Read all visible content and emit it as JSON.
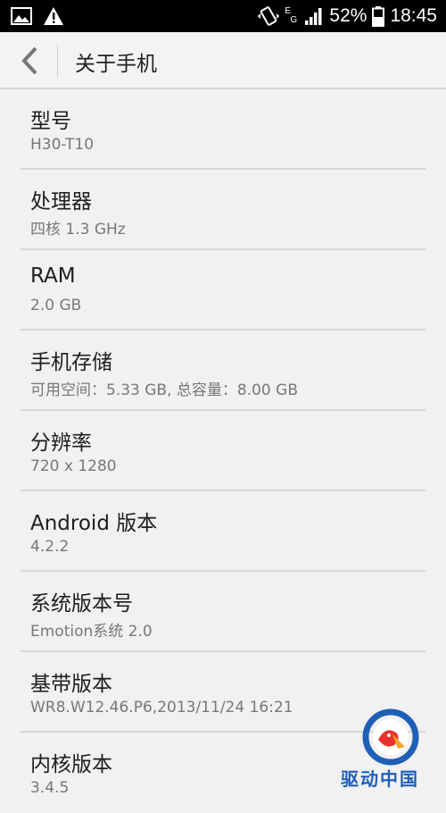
{
  "status_bar": {
    "battery_percent": "52%",
    "time": "18:45",
    "network_type_1": "E",
    "network_type_2": "G",
    "icons": [
      "image-notification-icon",
      "warning-icon",
      "vibrate-icon",
      "signal-icon",
      "battery-icon"
    ]
  },
  "action_bar": {
    "title": "关于手机",
    "back_icon": "chevron-left-icon"
  },
  "items": [
    {
      "label": "型号",
      "value": "H30-T10"
    },
    {
      "label": "处理器",
      "value": "四核 1.3 GHz"
    },
    {
      "label": "RAM",
      "value": "2.0 GB"
    },
    {
      "label": "手机存储",
      "value": "可用空间：5.33  GB, 总容量：8.00  GB"
    },
    {
      "label": "分辨率",
      "value": "720 x 1280"
    },
    {
      "label": "Android 版本",
      "value": "4.2.2"
    },
    {
      "label": "系统版本号",
      "value": "Emotion系统 2.0"
    },
    {
      "label": "基带版本",
      "value": "WR8.W12.46.P6,2013/11/24 16:21"
    },
    {
      "label": "内核版本",
      "value": "3.4.5"
    }
  ],
  "watermark": {
    "text": "驱动中国"
  },
  "colors": {
    "accent": "#1f5fb8",
    "background": "#f1f1f1"
  }
}
